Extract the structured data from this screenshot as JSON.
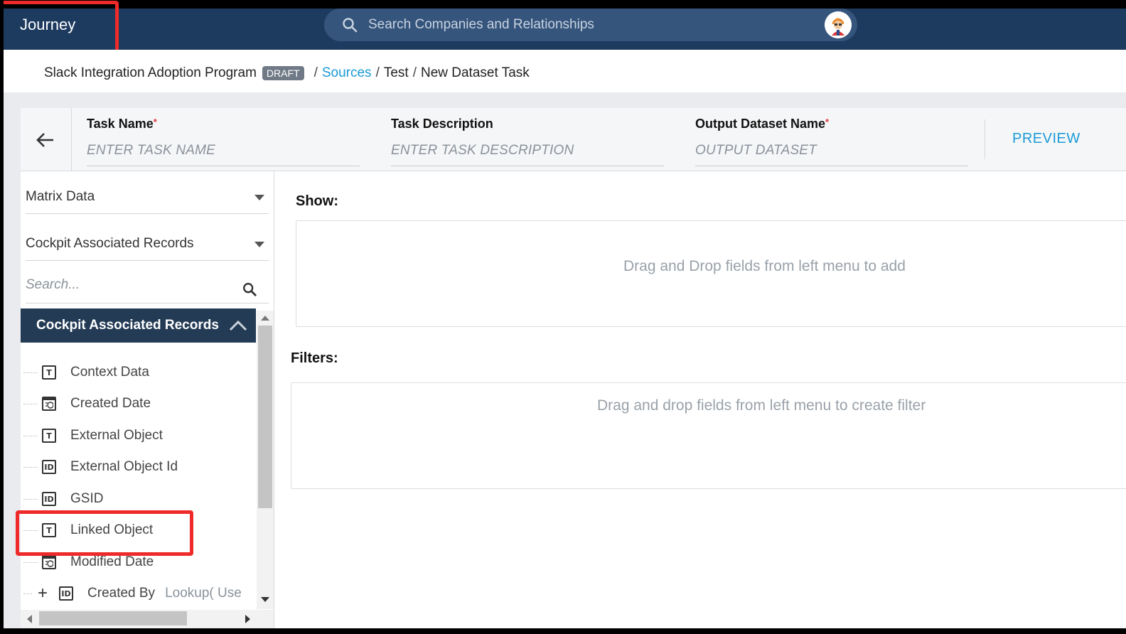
{
  "app": {
    "title": "Journey"
  },
  "search": {
    "placeholder": "Search Companies and Relationships"
  },
  "breadcrumb": {
    "program": "Slack Integration Adoption Program",
    "status": "DRAFT",
    "separator": "/",
    "sources": "Sources",
    "source": "Test",
    "current": "New Dataset Task"
  },
  "form": {
    "task_name_label": "Task Name",
    "task_name_placeholder": "ENTER TASK NAME",
    "task_desc_label": "Task Description",
    "task_desc_placeholder": "ENTER TASK DESCRIPTION",
    "output_label": "Output Dataset Name",
    "output_placeholder": "OUTPUT DATASET",
    "required_mark": "*",
    "preview": "PREVIEW"
  },
  "left": {
    "source_select": "Matrix Data",
    "object_select": "Cockpit Associated Records",
    "search_placeholder": "Search...",
    "group_title": "Cockpit Associated Records",
    "fields": [
      {
        "label": "Context Data",
        "icon": "text-type-icon",
        "glyph": "T"
      },
      {
        "label": "Created Date",
        "icon": "date-type-icon",
        "glyph": ""
      },
      {
        "label": "External Object",
        "icon": "text-type-icon",
        "glyph": "T"
      },
      {
        "label": "External Object Id",
        "icon": "id-type-icon",
        "glyph": "ID"
      },
      {
        "label": "GSID",
        "icon": "id-type-icon",
        "glyph": "ID"
      },
      {
        "label": "Linked Object",
        "icon": "text-type-icon",
        "glyph": "T"
      },
      {
        "label": "Modified Date",
        "icon": "date-type-icon",
        "glyph": ""
      }
    ],
    "lookup": {
      "label": "Created By",
      "type": "Lookup( Use",
      "expand": "+",
      "glyph": "ID"
    }
  },
  "right": {
    "show_title": "Show:",
    "show_hint": "Drag and Drop fields from left menu to add",
    "filters_title": "Filters:",
    "filters_hint": "Drag and drop fields from left menu to create filter"
  },
  "colors": {
    "topbar": "#1d3a5f",
    "accent": "#1a9ad6",
    "highlight": "#ee2a2a",
    "group_head": "#243b55"
  }
}
